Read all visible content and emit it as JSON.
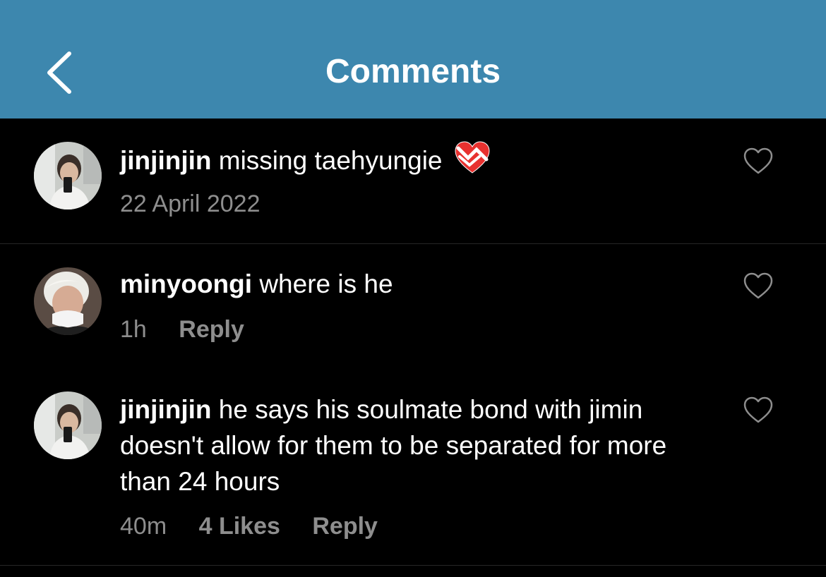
{
  "header": {
    "title": "Comments",
    "back_icon": "chevron-left-icon",
    "background_color": "#3d87ae"
  },
  "comments": [
    {
      "username": "jinjinjin",
      "text": "missing taehyungie",
      "emoji": "mending-heart-emoji",
      "timestamp": "22 April 2022",
      "avatar": "avatar-photo-jinjinjin"
    },
    {
      "username": "minyoongi",
      "text": "where is he",
      "timestamp": "1h",
      "reply_label": "Reply",
      "avatar": "avatar-photo-minyoongi"
    },
    {
      "username": "jinjinjin",
      "text": "he says his soulmate bond with jimin doesn't allow for them to be separated for more than 24 hours",
      "timestamp": "40m",
      "likes": "4 Likes",
      "reply_label": "Reply",
      "avatar": "avatar-photo-jinjinjin"
    }
  ],
  "colors": {
    "meta_text": "#8e8e8e",
    "divider": "#262626",
    "heart_outline": "#8e8e8e"
  }
}
